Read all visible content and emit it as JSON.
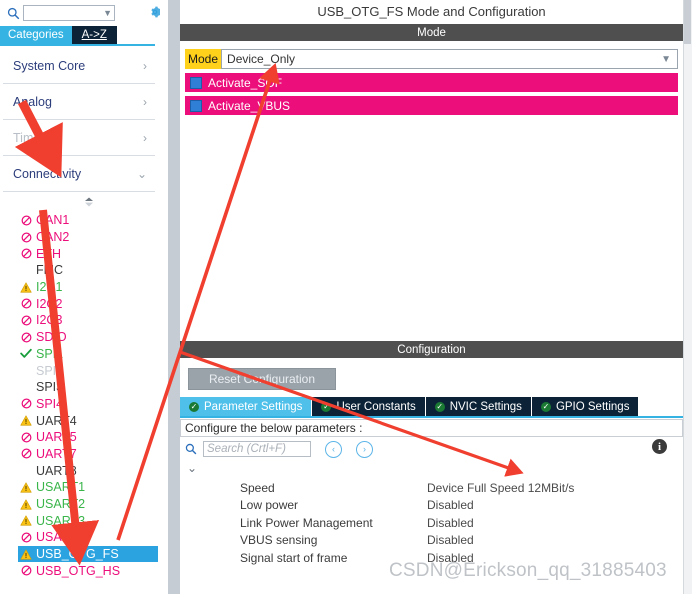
{
  "left_panel": {
    "search": {
      "value": "",
      "placeholder": ""
    },
    "gear_icon": "gear-icon",
    "tabs": [
      {
        "label": "Categories",
        "active": true
      },
      {
        "label": "A->Z",
        "active": false
      }
    ],
    "categories": [
      {
        "label": "System Core",
        "state": "collapsed",
        "disabled": false
      },
      {
        "label": "Analog",
        "state": "collapsed",
        "disabled": false
      },
      {
        "label": "Timers",
        "state": "collapsed",
        "disabled": true
      },
      {
        "label": "Connectivity",
        "state": "expanded",
        "disabled": false
      }
    ],
    "peripherals": [
      {
        "name": "CAN1",
        "icon": "no-entry-icon",
        "style": "pink"
      },
      {
        "name": "CAN2",
        "icon": "no-entry-icon",
        "style": "pink"
      },
      {
        "name": "ETH",
        "icon": "no-entry-icon",
        "style": "pink"
      },
      {
        "name": "FMC",
        "icon": "none",
        "style": "gray"
      },
      {
        "name": "I2C1",
        "icon": "warning-icon",
        "style": "green"
      },
      {
        "name": "I2C2",
        "icon": "no-entry-icon",
        "style": "pink"
      },
      {
        "name": "I2C3",
        "icon": "no-entry-icon",
        "style": "pink"
      },
      {
        "name": "SDIO",
        "icon": "no-entry-icon",
        "style": "pink"
      },
      {
        "name": "SPI1",
        "icon": "check-icon",
        "style": "green"
      },
      {
        "name": "SPI2",
        "icon": "none",
        "style": "dim"
      },
      {
        "name": "SPI3",
        "icon": "none",
        "style": "gray"
      },
      {
        "name": "SPI4",
        "icon": "no-entry-icon",
        "style": "pink"
      },
      {
        "name": "UART4",
        "icon": "warning-icon",
        "style": "gray"
      },
      {
        "name": "UART5",
        "icon": "no-entry-icon",
        "style": "pink"
      },
      {
        "name": "UART7",
        "icon": "no-entry-icon",
        "style": "pink"
      },
      {
        "name": "UART8",
        "icon": "none",
        "style": "gray"
      },
      {
        "name": "USART1",
        "icon": "warning-icon",
        "style": "green"
      },
      {
        "name": "USART2",
        "icon": "warning-icon",
        "style": "green"
      },
      {
        "name": "USART3",
        "icon": "warning-icon",
        "style": "green"
      },
      {
        "name": "USART6",
        "icon": "no-entry-icon",
        "style": "pink"
      },
      {
        "name": "USB_OTG_FS",
        "icon": "warning-icon",
        "style": "selected"
      },
      {
        "name": "USB_OTG_HS",
        "icon": "no-entry-icon",
        "style": "pink"
      }
    ]
  },
  "right_panel": {
    "title": "USB_OTG_FS Mode and Configuration",
    "mode_section": {
      "header": "Mode",
      "mode_label": "Mode",
      "mode_value": "Device_Only",
      "checkboxes": [
        {
          "label": "Activate_SOF",
          "checked": true
        },
        {
          "label": "Activate_VBUS",
          "checked": true
        }
      ]
    },
    "config_section": {
      "header": "Configuration",
      "reset_button": "Reset Configuration",
      "tabs": [
        {
          "label": "Parameter Settings",
          "active": true,
          "status": "ok"
        },
        {
          "label": "User Constants",
          "active": false,
          "status": "ok"
        },
        {
          "label": "NVIC Settings",
          "active": false,
          "status": "ok"
        },
        {
          "label": "GPIO Settings",
          "active": false,
          "status": "ok"
        }
      ],
      "hint": "Configure the below parameters :",
      "search_placeholder": "Search (Crtl+F)",
      "nav_prev": "‹",
      "nav_next": "›",
      "info_icon": "info-icon",
      "parameters": [
        {
          "name": "Speed",
          "value": "Device Full Speed 12MBit/s"
        },
        {
          "name": "Low power",
          "value": "Disabled"
        },
        {
          "name": "Link Power Management",
          "value": "Disabled"
        },
        {
          "name": "VBUS sensing",
          "value": "Disabled"
        },
        {
          "name": "Signal start of frame",
          "value": "Disabled"
        }
      ]
    }
  },
  "watermark": "CSDN@Erickson_qq_31885403",
  "colors": {
    "accent_blue": "#35b4e3",
    "tab_dark": "#0c2337",
    "magenta": "#ec0e7b",
    "gold": "#ffd11a",
    "green": "#3ab54a",
    "arrow_red": "#f03e2f",
    "section_gray": "#4f4f4f"
  }
}
